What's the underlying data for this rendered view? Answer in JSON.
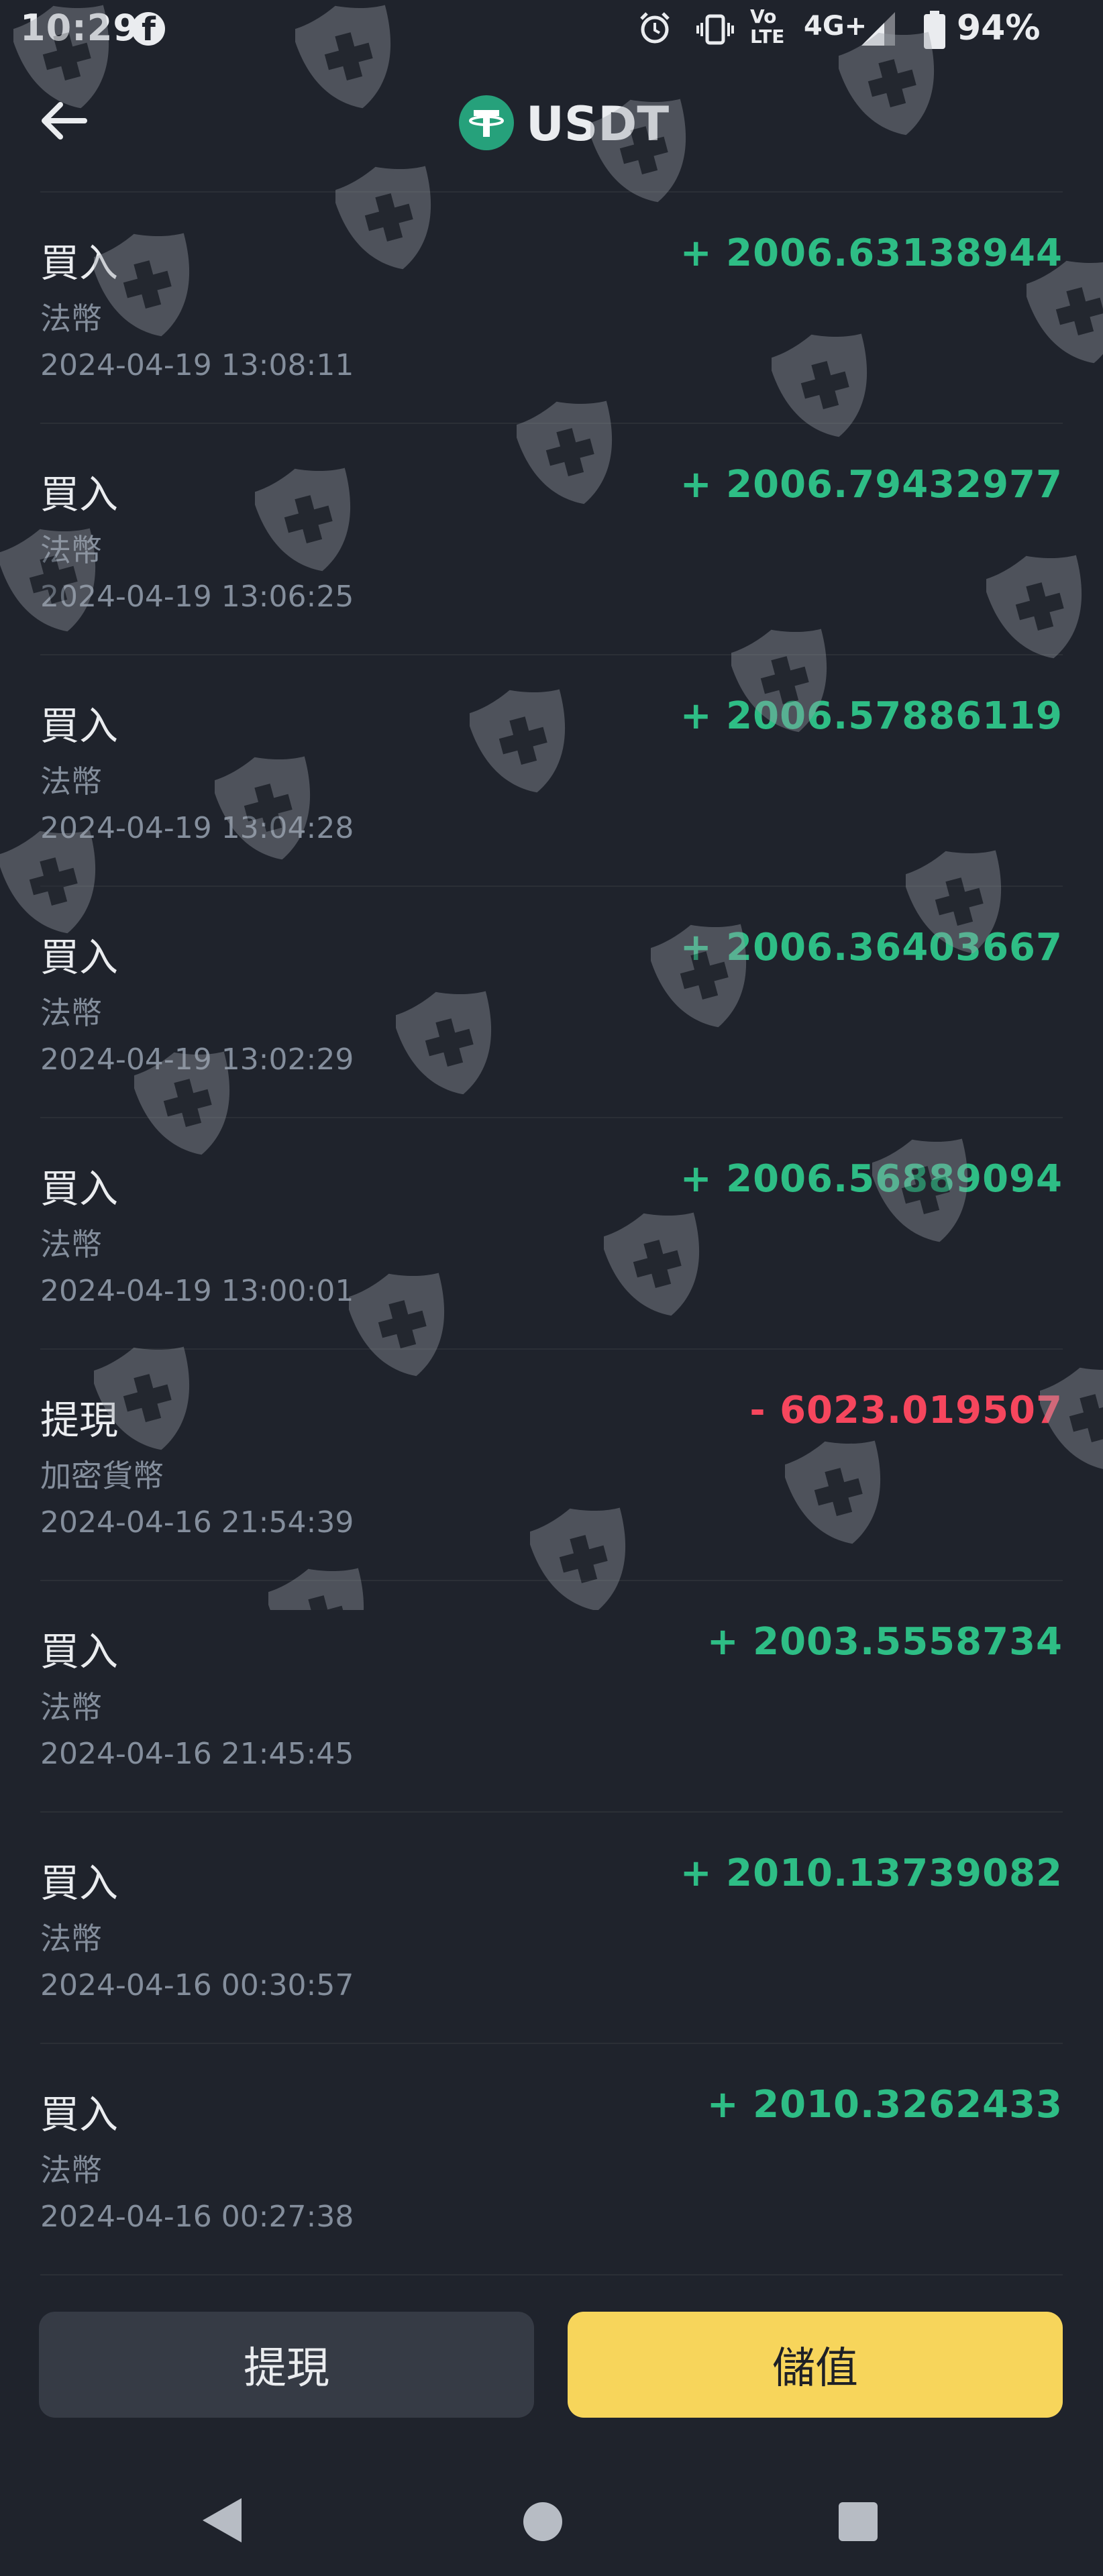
{
  "status_bar": {
    "time": "10:29",
    "network_top": "Vo",
    "network_bottom": "LTE",
    "network_type": "4G+",
    "battery": "94%"
  },
  "header": {
    "title": "USDT",
    "coin_icon": "tether-icon"
  },
  "transactions": [
    {
      "type": "買入",
      "category": "法幣",
      "time": "2024-04-19 13:08:11",
      "amount": "+ 2006.63138944",
      "direction": "in"
    },
    {
      "type": "買入",
      "category": "法幣",
      "time": "2024-04-19 13:06:25",
      "amount": "+ 2006.79432977",
      "direction": "in"
    },
    {
      "type": "買入",
      "category": "法幣",
      "time": "2024-04-19 13:04:28",
      "amount": "+ 2006.57886119",
      "direction": "in"
    },
    {
      "type": "買入",
      "category": "法幣",
      "time": "2024-04-19 13:02:29",
      "amount": "+ 2006.36403667",
      "direction": "in"
    },
    {
      "type": "買入",
      "category": "法幣",
      "time": "2024-04-19 13:00:01",
      "amount": "+ 2006.56889094",
      "direction": "in"
    },
    {
      "type": "提現",
      "category": "加密貨幣",
      "time": "2024-04-16 21:54:39",
      "amount": "- 6023.019507",
      "direction": "out"
    },
    {
      "type": "買入",
      "category": "法幣",
      "time": "2024-04-16 21:45:45",
      "amount": "+ 2003.5558734",
      "direction": "in"
    },
    {
      "type": "買入",
      "category": "法幣",
      "time": "2024-04-16 00:30:57",
      "amount": "+ 2010.13739082",
      "direction": "in"
    },
    {
      "type": "買入",
      "category": "法幣",
      "time": "2024-04-16 00:27:38",
      "amount": "+ 2010.3262433",
      "direction": "in"
    }
  ],
  "actions": {
    "withdraw_label": "提現",
    "deposit_label": "儲值"
  },
  "colors": {
    "background": "#1f232c",
    "positive": "#2ebd85",
    "negative": "#f6465d",
    "deposit_button": "#f7d55b",
    "withdraw_button": "#363b45"
  }
}
